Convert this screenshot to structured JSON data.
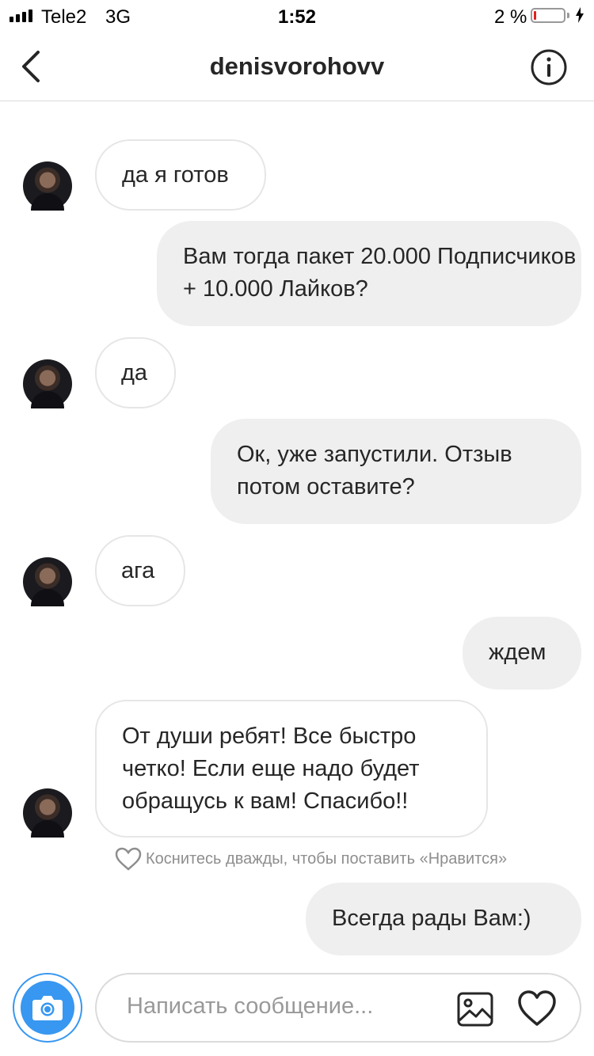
{
  "status_bar": {
    "carrier": "Tele2",
    "network": "3G",
    "time": "1:52",
    "battery_percent": "2 %",
    "battery_level": 0.02,
    "battery_color": "#e0201b"
  },
  "header": {
    "back_icon": "chevron-left-icon",
    "username": "denisvorohovv",
    "info_icon": "info-icon"
  },
  "messages": [
    {
      "direction": "incoming",
      "text": "да я готов"
    },
    {
      "direction": "outgoing",
      "text": "Вам тогда пакет 20.000 Подписчиков + 10.000 Лайков?"
    },
    {
      "direction": "incoming",
      "text": "да"
    },
    {
      "direction": "outgoing",
      "text": "Ок, уже запустили. Отзыв потом оставите?"
    },
    {
      "direction": "incoming",
      "text": "ага"
    },
    {
      "direction": "outgoing",
      "text": "ждем"
    },
    {
      "direction": "incoming",
      "text": "От души ребят! Все быстро четко! Если еще надо будет обращусь к вам! Спасибо!!"
    },
    {
      "direction": "outgoing",
      "text": "Всегда рады Вам:)"
    }
  ],
  "like_hint": "Коснитесь дважды, чтобы поставить «Нравится»",
  "composer": {
    "placeholder": "Написать сообщение...",
    "camera_icon": "camera-icon",
    "gallery_icon": "gallery-icon",
    "heart_icon": "heart-icon",
    "accent_color": "#3897f0"
  }
}
